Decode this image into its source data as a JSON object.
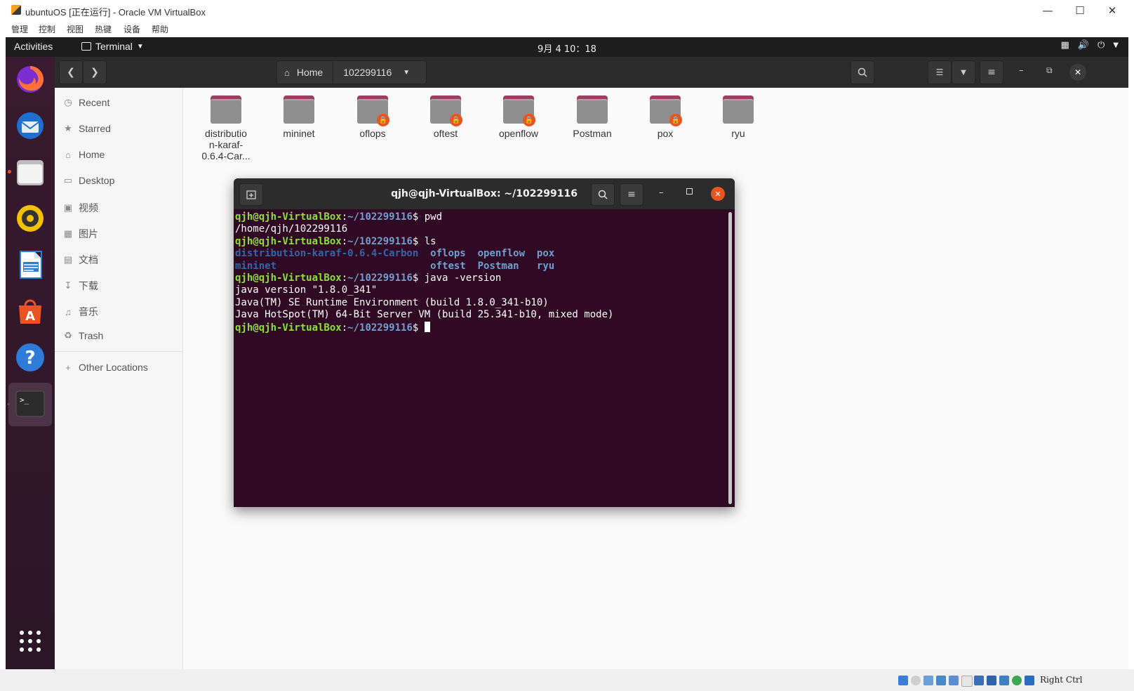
{
  "window": {
    "title": "ubuntuOS [正在运行] - Oracle VM VirtualBox",
    "menu": [
      "管理",
      "控制",
      "视图",
      "热键",
      "设备",
      "帮助"
    ]
  },
  "topbar": {
    "activities": "Activities",
    "app_menu": "Terminal",
    "clock": "9月 4  10：18"
  },
  "dock": {
    "items": [
      {
        "name": "firefox-icon"
      },
      {
        "name": "thunderbird-icon"
      },
      {
        "name": "files-icon",
        "running": true
      },
      {
        "name": "rhythmbox-icon"
      },
      {
        "name": "libreoffice-writer-icon"
      },
      {
        "name": "ubuntu-software-icon"
      },
      {
        "name": "help-icon"
      },
      {
        "name": "terminal-icon",
        "running": true,
        "active": true
      }
    ],
    "show_apps": "show-applications-icon"
  },
  "files": {
    "path": {
      "home": "Home",
      "current": "102299116"
    },
    "sidebar": [
      {
        "label": "Recent",
        "icon": "clock-icon"
      },
      {
        "label": "Starred",
        "icon": "star-icon"
      },
      {
        "label": "Home",
        "icon": "home-icon"
      },
      {
        "label": "Desktop",
        "icon": "desktop-icon"
      },
      {
        "label": "视频",
        "icon": "video-icon"
      },
      {
        "label": "图片",
        "icon": "picture-icon"
      },
      {
        "label": "文档",
        "icon": "document-icon"
      },
      {
        "label": "下载",
        "icon": "download-icon"
      },
      {
        "label": "音乐",
        "icon": "music-icon"
      },
      {
        "label": "Trash",
        "icon": "trash-icon"
      },
      {
        "label": "Other Locations",
        "icon": "plus-icon"
      }
    ],
    "folders": [
      {
        "name": "distributio n-karaf- 0.6.4-Car...",
        "lines": [
          "distributio",
          "n-karaf-",
          "0.6.4-Car..."
        ],
        "locked": false
      },
      {
        "name": "mininet",
        "lines": [
          "mininet"
        ],
        "locked": false
      },
      {
        "name": "oflops",
        "lines": [
          "oflops"
        ],
        "locked": true
      },
      {
        "name": "oftest",
        "lines": [
          "oftest"
        ],
        "locked": true
      },
      {
        "name": "openflow",
        "lines": [
          "openflow"
        ],
        "locked": true
      },
      {
        "name": "Postman",
        "lines": [
          "Postman"
        ],
        "locked": false
      },
      {
        "name": "pox",
        "lines": [
          "pox"
        ],
        "locked": true
      },
      {
        "name": "ryu",
        "lines": [
          "ryu"
        ],
        "locked": false
      }
    ]
  },
  "terminal": {
    "title": "qjh@qjh-VirtualBox: ~/102299116",
    "prompt_user": "qjh@qjh-VirtualBox",
    "prompt_path": "~/102299116",
    "lines": [
      {
        "type": "cmd",
        "text": "pwd"
      },
      {
        "type": "out",
        "text": "/home/qjh/102299116"
      },
      {
        "type": "cmd",
        "text": "ls"
      },
      {
        "type": "ls",
        "text": "distribution-karaf-0.6.4-Carbon  oflops  openflow  pox"
      },
      {
        "type": "ls",
        "text": "mininet                          oftest  Postman   ryu"
      },
      {
        "type": "cmd",
        "text": "java -version"
      },
      {
        "type": "out",
        "text": "java version \"1.8.0_341\""
      },
      {
        "type": "out",
        "text": "Java(TM) SE Runtime Environment (build 1.8.0_341-b10)"
      },
      {
        "type": "out",
        "text": "Java HotSpot(TM) 64-Bit Server VM (build 25.341-b10, mixed mode)"
      },
      {
        "type": "cmd",
        "text": ""
      }
    ]
  },
  "statusbar": {
    "host_key": "Right Ctrl"
  }
}
